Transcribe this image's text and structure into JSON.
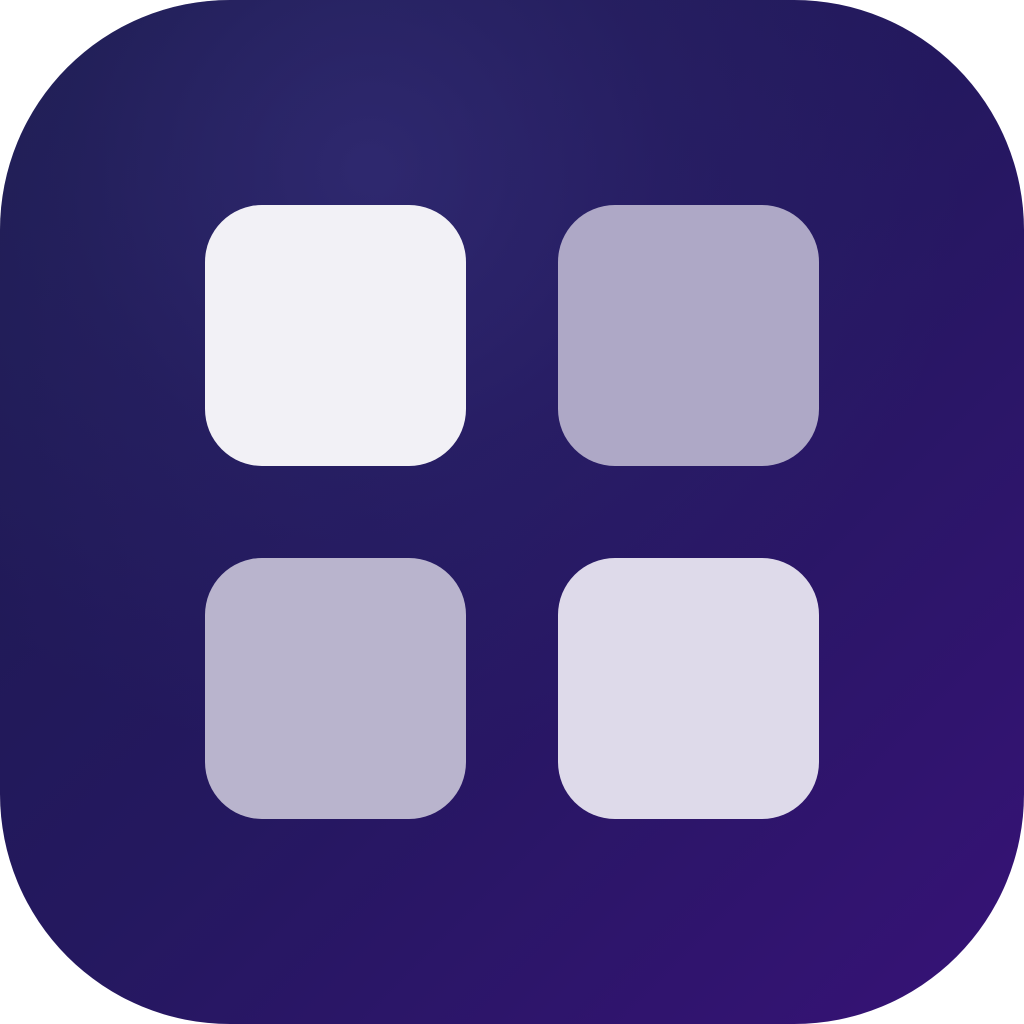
{
  "icon": {
    "name": "grid-apps-icon",
    "background_colors": [
      "#1c1c4e",
      "#24185f",
      "#371277"
    ],
    "tiles": [
      {
        "id": "tile-tl",
        "color": "#f2f1f6"
      },
      {
        "id": "tile-tr",
        "color": "#aea8c6"
      },
      {
        "id": "tile-bl",
        "color": "#b9b4cd"
      },
      {
        "id": "tile-br",
        "color": "#dedaea"
      }
    ]
  }
}
